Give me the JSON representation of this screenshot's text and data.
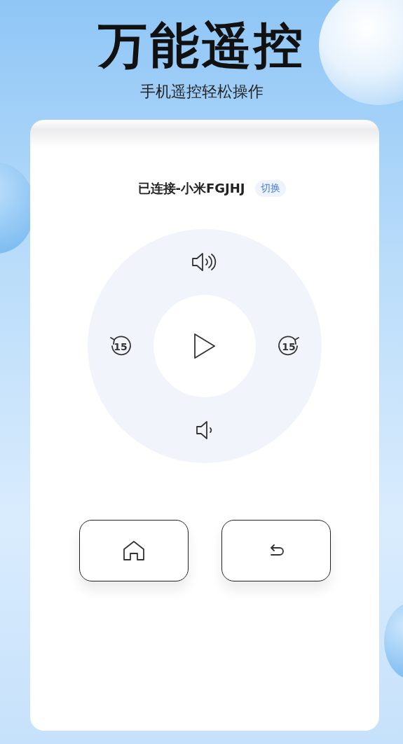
{
  "header": {
    "title": "万能遥控",
    "subtitle": "手机遥控轻松操作"
  },
  "connection": {
    "status": "已连接-小米FGJHJ",
    "switch_label": "切换"
  },
  "dial": {
    "buttons": [
      {
        "kind": "volume_up"
      },
      {
        "kind": "rewind",
        "label": "15"
      },
      {
        "kind": "play"
      },
      {
        "kind": "forward",
        "label": "15"
      },
      {
        "kind": "volume_down"
      }
    ]
  },
  "keys": [
    {
      "kind": "home"
    },
    {
      "kind": "back"
    }
  ]
}
